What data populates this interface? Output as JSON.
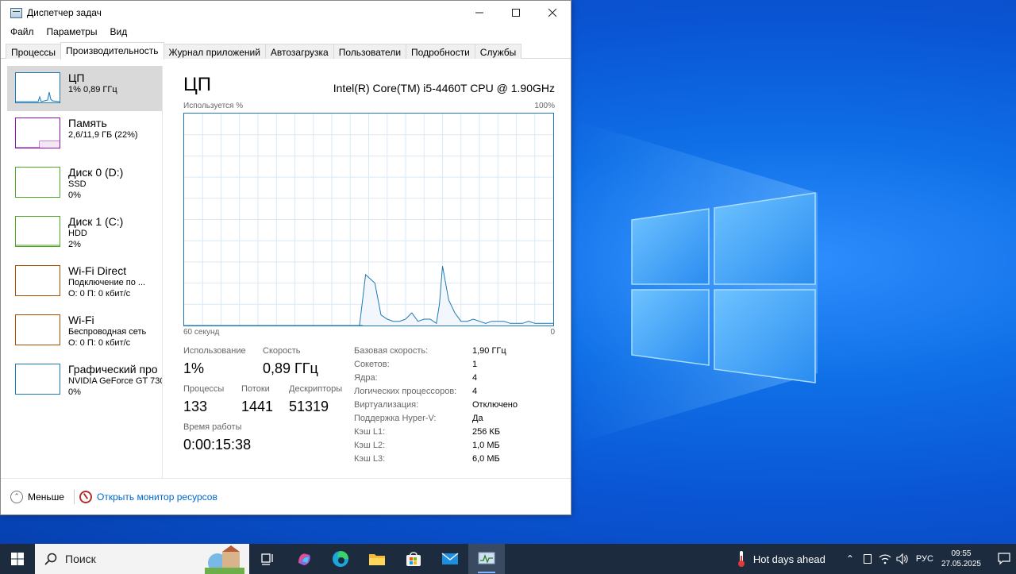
{
  "window": {
    "title": "Диспетчер задач",
    "menu": [
      "Файл",
      "Параметры",
      "Вид"
    ],
    "tabs": [
      "Процессы",
      "Производительность",
      "Журнал приложений",
      "Автозагрузка",
      "Пользователи",
      "Подробности",
      "Службы"
    ],
    "active_tab": "Производительность"
  },
  "sidebar": {
    "items": [
      {
        "name": "ЦП",
        "line1": "1% 0,89 ГГц",
        "line2": "",
        "color": "#1e78b4"
      },
      {
        "name": "Память",
        "line1": "2,6/11,9 ГБ (22%)",
        "line2": "",
        "color": "#8b12ae"
      },
      {
        "name": "Диск 0 (D:)",
        "line1": "SSD",
        "line2": "0%",
        "color": "#4ca820"
      },
      {
        "name": "Диск 1 (C:)",
        "line1": "HDD",
        "line2": "2%",
        "color": "#4ca820"
      },
      {
        "name": "Wi-Fi Direct",
        "line1": "Подключение по ...",
        "line2": "О: 0 П: 0 кбит/с",
        "color": "#a74f01"
      },
      {
        "name": "Wi-Fi",
        "line1": "Беспроводная сеть",
        "line2": "О: 0 П: 0 кбит/с",
        "color": "#a74f01"
      },
      {
        "name": "Графический про",
        "line1": "NVIDIA GeForce GT 730",
        "line2": "0%",
        "color": "#1e78b4"
      }
    ]
  },
  "cpu": {
    "title": "ЦП",
    "model": "Intel(R) Core(TM) i5-4460T CPU @ 1.90GHz",
    "graph_top_left": "Используется %",
    "graph_top_right": "100%",
    "graph_bottom_left": "60 секунд",
    "graph_bottom_right": "0",
    "stats": {
      "usage_label": "Использование",
      "usage_value": "1%",
      "speed_label": "Скорость",
      "speed_value": "0,89 ГГц",
      "processes_label": "Процессы",
      "processes_value": "133",
      "threads_label": "Потоки",
      "threads_value": "1441",
      "handles_label": "Дескрипторы",
      "handles_value": "51319",
      "uptime_label": "Время работы",
      "uptime_value": "0:00:15:38"
    },
    "info": [
      {
        "key": "Базовая скорость:",
        "value": "1,90 ГГц"
      },
      {
        "key": "Сокетов:",
        "value": "1"
      },
      {
        "key": "Ядра:",
        "value": "4"
      },
      {
        "key": "Логических процессоров:",
        "value": "4"
      },
      {
        "key": "Виртуализация:",
        "value": "Отключено"
      },
      {
        "key": "Поддержка Hyper-V:",
        "value": "Да"
      },
      {
        "key": "Кэш L1:",
        "value": "256 КБ"
      },
      {
        "key": "Кэш L2:",
        "value": "1,0 МБ"
      },
      {
        "key": "Кэш L3:",
        "value": "6,0 МБ"
      }
    ]
  },
  "chart_data": {
    "type": "area",
    "xlim": [
      60,
      0
    ],
    "ylim": [
      0,
      100
    ],
    "grid": true,
    "x": [
      60,
      59,
      58,
      57,
      56,
      55,
      54,
      53,
      52,
      51,
      50,
      49,
      48,
      47,
      46,
      45,
      44,
      43,
      42,
      41,
      40,
      39,
      38,
      37,
      36,
      35,
      34,
      33,
      32,
      31,
      31.5,
      31,
      30.5,
      29,
      28,
      27,
      26,
      25,
      24,
      23,
      22,
      21,
      20,
      19,
      18.5,
      18,
      17,
      16,
      15,
      14,
      13,
      12,
      11,
      10,
      9,
      8,
      7,
      6,
      5,
      4,
      3,
      2,
      1,
      0
    ],
    "values": [
      0,
      0,
      0,
      0,
      0,
      0,
      0,
      0,
      0,
      0,
      0,
      0,
      0,
      0,
      0,
      0,
      0,
      0,
      0,
      0,
      0,
      0,
      0,
      0,
      0,
      0,
      0,
      0,
      0,
      0,
      0,
      12,
      24,
      20,
      5,
      3,
      2,
      2,
      3,
      6,
      2,
      3,
      3,
      1,
      10,
      28,
      12,
      6,
      2,
      2,
      3,
      2,
      1,
      2,
      2,
      2,
      1,
      1,
      1,
      2,
      1,
      1,
      1,
      1
    ]
  },
  "footer": {
    "less": "Меньше",
    "resmon": "Открыть монитор ресурсов"
  },
  "taskbar": {
    "search": "Поиск",
    "weather": "Hot days ahead",
    "lang": "РУС",
    "time": "09:55",
    "date": "27.05.2025"
  }
}
